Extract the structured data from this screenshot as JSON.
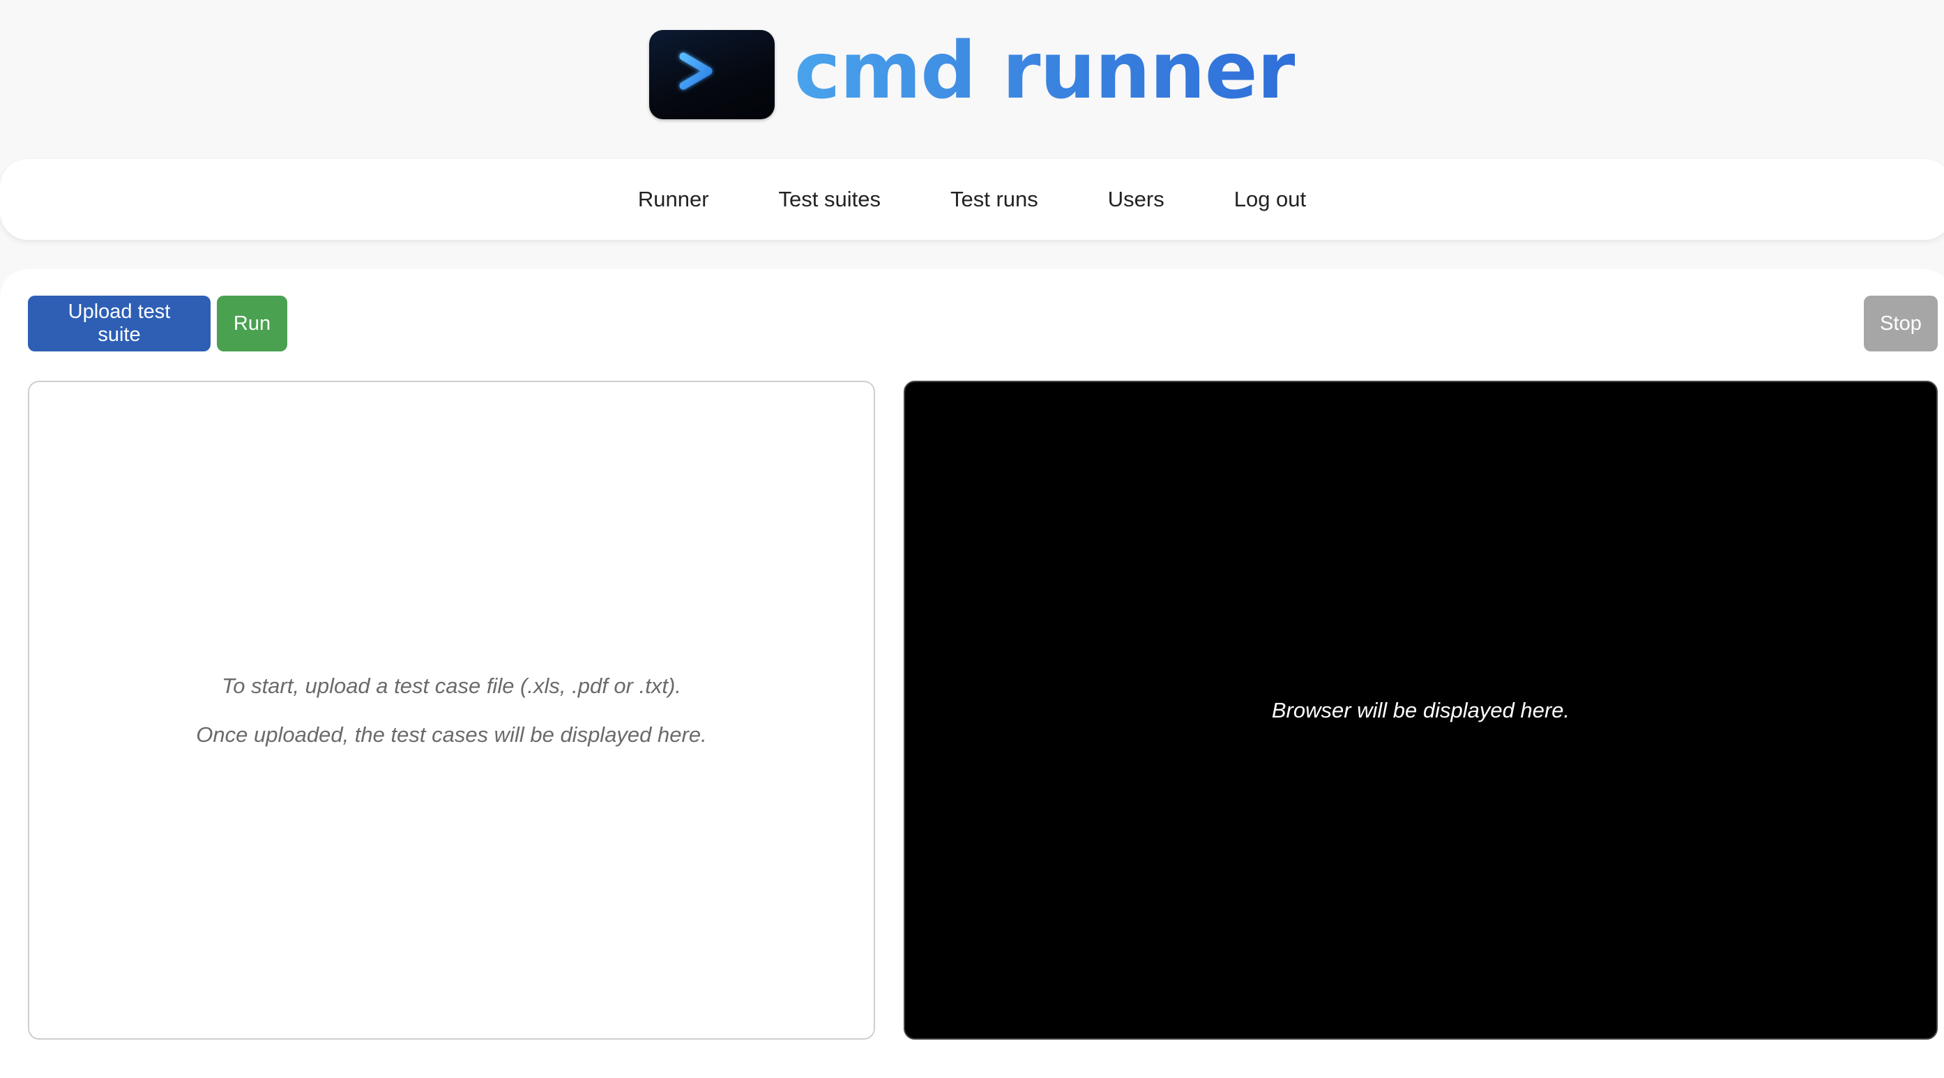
{
  "app": {
    "title": "cmd runner",
    "logo_icon": "terminal-prompt-icon"
  },
  "colors": {
    "accent_blue": "#2e5fb5",
    "run_green": "#4aa150",
    "stop_gray": "#a6a6a6",
    "brand_gradient_start": "#4aa3ec",
    "brand_gradient_end": "#2f6fd9"
  },
  "nav": {
    "items": [
      {
        "label": "Runner"
      },
      {
        "label": "Test suites"
      },
      {
        "label": "Test runs"
      },
      {
        "label": "Users"
      },
      {
        "label": "Log out"
      }
    ]
  },
  "toolbar": {
    "upload_label": "Upload test suite",
    "run_label": "Run",
    "stop_label": "Stop"
  },
  "test_cases_panel": {
    "line1": "To start, upload a test case file (.xls, .pdf or .txt).",
    "line2": "Once uploaded, the test cases will be displayed here."
  },
  "browser_panel": {
    "placeholder": "Browser will be displayed here."
  }
}
